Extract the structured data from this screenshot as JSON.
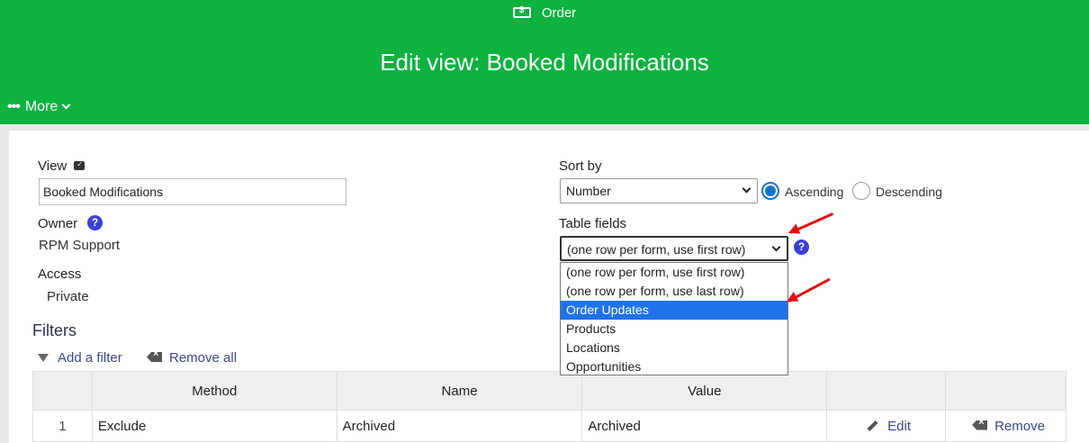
{
  "header": {
    "context_label": "Order",
    "title": "Edit view: Booked Modifications",
    "more_label": "More"
  },
  "form": {
    "view_label": "View",
    "view_value": "Booked Modifications",
    "owner_label": "Owner",
    "owner_value": "RPM Support",
    "access_label": "Access",
    "access_value": "Private",
    "sort_label": "Sort by",
    "sort_selected": "Number",
    "sort_ascending": "Ascending",
    "sort_descending": "Descending",
    "sort_order": "Ascending",
    "table_fields_label": "Table fields",
    "table_fields_selected": "(one row per form, use first row)",
    "table_fields_options": [
      "(one row per form, use first row)",
      "(one row per form, use last row)",
      "Order Updates",
      "Products",
      "Locations",
      "Opportunities"
    ],
    "highlighted_option": "Order Updates"
  },
  "filters": {
    "title": "Filters",
    "add_label": "Add a filter",
    "remove_all_label": "Remove all",
    "columns": [
      "",
      "Method",
      "Name",
      "Value",
      "",
      ""
    ],
    "rows": [
      {
        "num": "1",
        "method": "Exclude",
        "name": "Archived",
        "value": "Archived",
        "edit": "Edit",
        "remove": "Remove"
      }
    ]
  },
  "colors": {
    "header_green": "#0db23f",
    "accent_blue": "#3b40d8",
    "highlight": "#1e73e8",
    "annotation_arrow": "#e01010"
  }
}
